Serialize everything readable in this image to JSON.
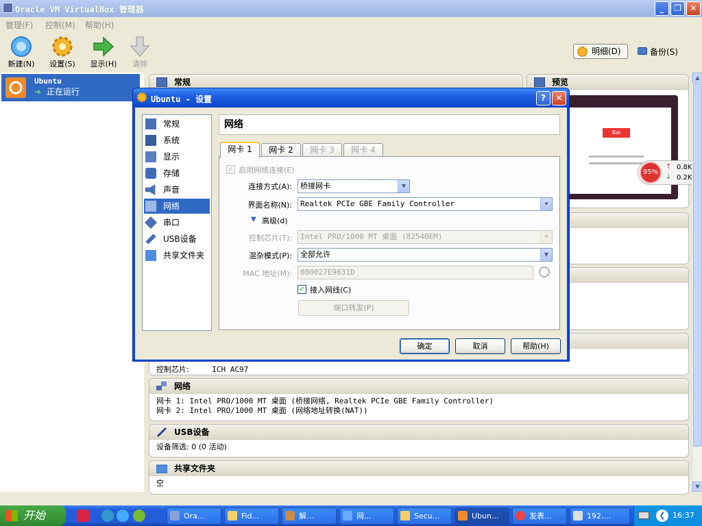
{
  "window": {
    "title": "Oracle VM VirtualBox 管理器"
  },
  "menu": [
    "管理(F)",
    "控制(M)",
    "帮助(H)"
  ],
  "toolbar": {
    "new": "新建(N)",
    "settings": "设置(S)",
    "show": "显示(H)",
    "discard": "清除",
    "details": "明细(D)",
    "snapshots": "备份(S)"
  },
  "vm": {
    "name": "Ubuntu",
    "state": "正在运行"
  },
  "panel": {
    "general": "常规",
    "preview": "预览",
    "audio_body": {
      "label": "控制芯片:",
      "value": "ICH AC97"
    },
    "network": {
      "title": "网络",
      "lines": [
        "网卡 1:  Intel PRO/1000 MT 桌面 (桥接网络, Realtek PCIe GBE Family Controller)",
        "网卡 2:  Intel PRO/1000 MT 桌面 (网络地址转换(NAT))"
      ]
    },
    "usb": {
      "title": "USB设备",
      "line": "设备筛选:  0 (0 活动)"
    },
    "shared": {
      "title": "共享文件夹",
      "line": "空"
    }
  },
  "netmeter": {
    "percent": "95%",
    "up": "0.8K/s",
    "down": "0.2K/s"
  },
  "dialog": {
    "title": "Ubuntu - 设置",
    "nav": [
      "常规",
      "系统",
      "显示",
      "存储",
      "声音",
      "网络",
      "串口",
      "USB设备",
      "共享文件夹"
    ],
    "selected_nav": "网络",
    "page_title": "网络",
    "tabs": [
      "网卡 1",
      "网卡 2",
      "网卡 3",
      "网卡 4"
    ],
    "enable_label": "启用网络连接(E)",
    "attach_label": "连接方式(A):",
    "attach_value": "桥接网卡",
    "iface_label": "界面名称(N):",
    "iface_value": "Realtek PCIe GBE Family Controller",
    "advanced": "高级(d)",
    "chip_label": "控制芯片(T):",
    "chip_value": "Intel PRO/1000 MT 桌面 (82540EM)",
    "promisc_label": "混杂模式(P):",
    "promisc_value": "全部允许",
    "mac_label": "MAC 地址(M):",
    "mac_value": "080027E9831D",
    "cable_label": "接入网线(C)",
    "portfwd": "端口转发(P)",
    "ok": "确定",
    "cancel": "取消",
    "help": "帮助(H)"
  },
  "taskbar": {
    "start": "开始",
    "tasks": [
      "Ora...",
      "Fid...",
      "解...",
      "网...",
      "Secu...",
      "Ubun...",
      "发表...",
      "192...."
    ],
    "clock": "16:37"
  }
}
